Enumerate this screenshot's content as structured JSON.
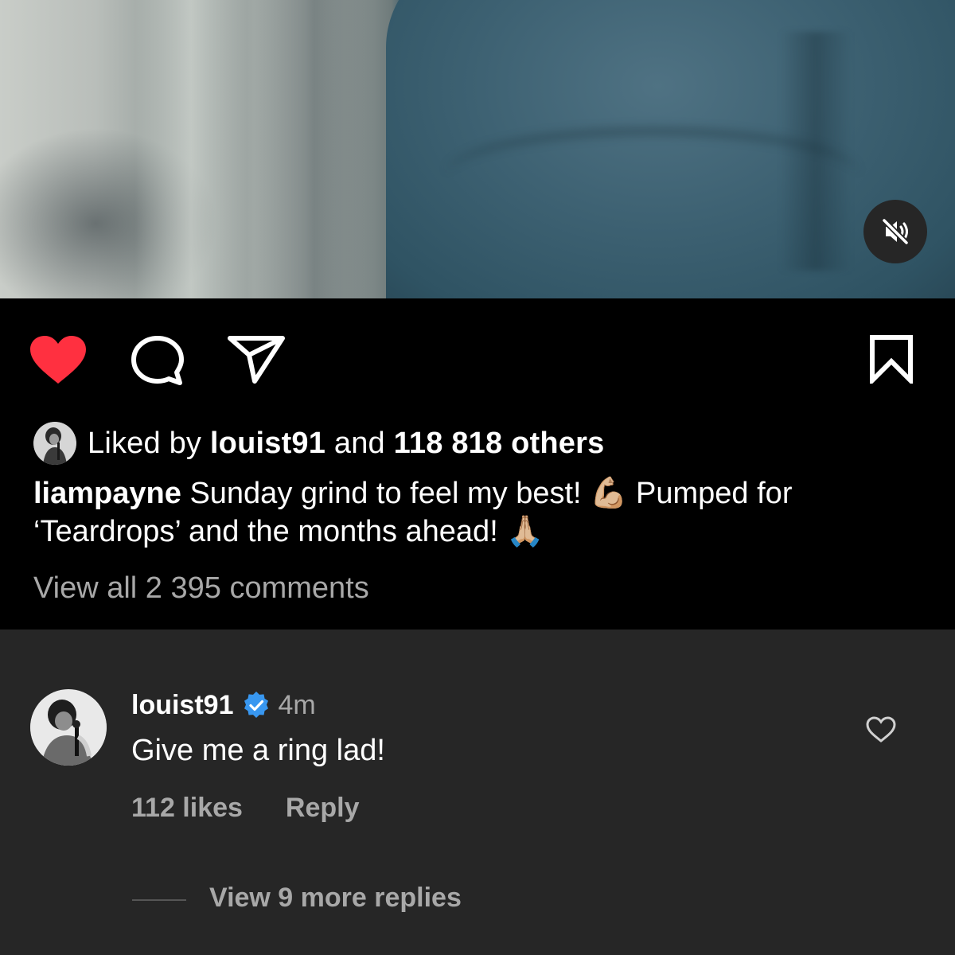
{
  "video": {
    "mute_icon": "speaker-muted-icon"
  },
  "actions": {
    "like_icon": "heart-filled-icon",
    "like_color": "#ff3040",
    "comment_icon": "comment-bubble-icon",
    "share_icon": "paper-plane-icon",
    "save_icon": "bookmark-icon"
  },
  "likes": {
    "prefix": "Liked by",
    "user": "louist91",
    "middle": "and",
    "others": "118 818 others"
  },
  "caption": {
    "username": "liampayne",
    "text_part1": "Sunday grind to feel my best! 💪🏼 Pumped for ‘Teardrops’ and the months ahead! 🙏🏼"
  },
  "view_all_comments": "View all 2 395 comments",
  "comment": {
    "username": "louist91",
    "verified_color": "#3897f0",
    "time": "4m",
    "text": "Give me a ring lad!",
    "likes": "112 likes",
    "reply": "Reply",
    "view_replies": "View 9 more replies"
  }
}
